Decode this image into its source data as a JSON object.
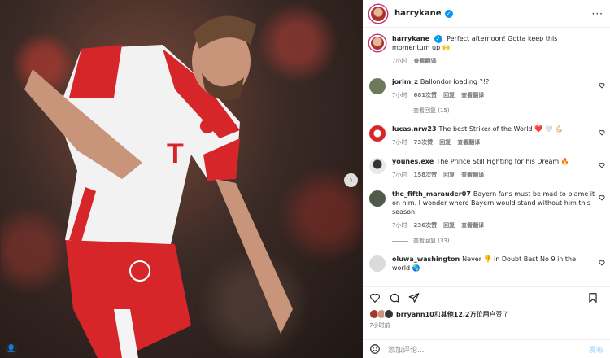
{
  "post": {
    "username": "harrykane",
    "caption": "Perfect afternoon! Gotta keep this momentum up 🙌",
    "caption_time": "7小时",
    "translate": "查看翻译"
  },
  "comments": [
    {
      "user": "jorim_z",
      "text": "Ballondor loading ?!?",
      "time": "7小时",
      "likes": "681次赞",
      "reply": "回复",
      "translate": "查看翻译",
      "replies": "查看回复 (15)"
    },
    {
      "user": "lucas.nrw23",
      "text": "The best Striker of the World ❤️ 🤍 💪🏻",
      "time": "7小时",
      "likes": "73次赞",
      "reply": "回复",
      "translate": "查看翻译",
      "replies": ""
    },
    {
      "user": "younes.exe",
      "text": "The Prince Still Fighting for his Dream 🔥",
      "time": "7小时",
      "likes": "158次赞",
      "reply": "回复",
      "translate": "查看翻译",
      "replies": ""
    },
    {
      "user": "the_fifth_marauder07",
      "text": "Bayern fans must be mad to blame it on him. I wonder where Bayern would stand without him this season.",
      "time": "7小时",
      "likes": "236次赞",
      "reply": "回复",
      "translate": "查看翻译",
      "replies": "查看回复 (33)"
    },
    {
      "user": "oluwa_washington",
      "text": "Never 👎 in Doubt Best No 9 in the world 🌎",
      "time": "",
      "likes": "",
      "reply": "",
      "translate": "",
      "replies": ""
    }
  ],
  "likes_line": {
    "user": "brryann10",
    "mid": "和",
    "others": "其他12.2万位用户",
    "end": "赞了"
  },
  "post_time": "7小时前",
  "add_comment": {
    "placeholder": "添加评论...",
    "post_label": "发布"
  },
  "icons": {
    "more": "more-icon",
    "heart": "heart-icon",
    "comment": "comment-icon",
    "share": "share-icon",
    "save": "bookmark-icon",
    "emoji": "emoji-icon",
    "next": "chevron-right-icon",
    "tag": "user-tag-icon"
  },
  "colors": {
    "verified": "#0095f6",
    "muted": "#737373",
    "post_disabled": "#b2dffc"
  }
}
